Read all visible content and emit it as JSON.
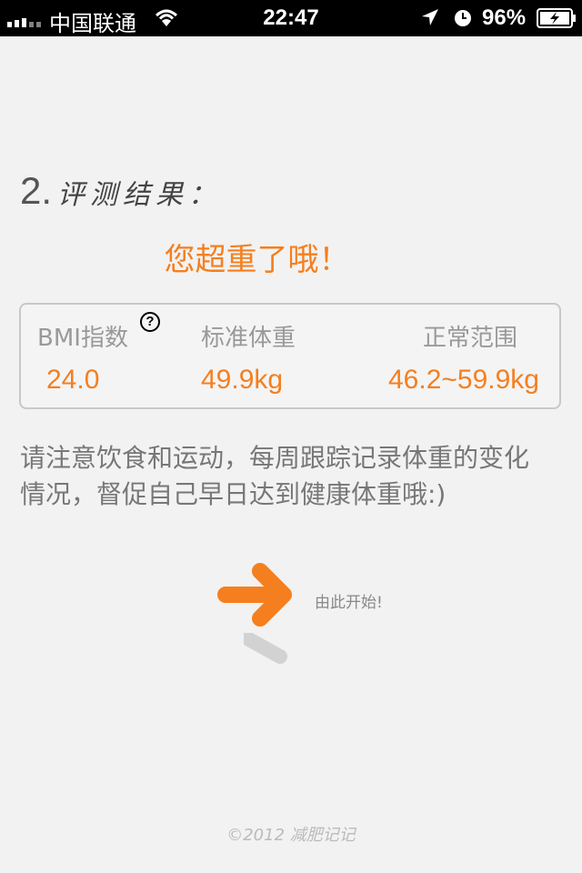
{
  "status_bar": {
    "carrier": "中国联通",
    "time": "22:47",
    "battery": "96%"
  },
  "section": {
    "number": "2.",
    "title": "评测结果："
  },
  "result": {
    "message": "您超重了哦！"
  },
  "metrics": {
    "bmi_label": "BMI指数",
    "bmi_value": "24.0",
    "standard_weight_label": "标准体重",
    "standard_weight_value": "49.9kg",
    "normal_range_label": "正常范围",
    "normal_range_value": "46.2~59.9kg"
  },
  "advice": "请注意饮食和运动，每周跟踪记录体重的变化情况，督促自己早日达到健康体重哦:)",
  "start": {
    "label": "由此开始!"
  },
  "footer": {
    "copyright": "©2012 减肥记记"
  },
  "colors": {
    "accent": "#f57f1f",
    "background": "#f2f2f2",
    "card_border": "#c8c8c8"
  }
}
